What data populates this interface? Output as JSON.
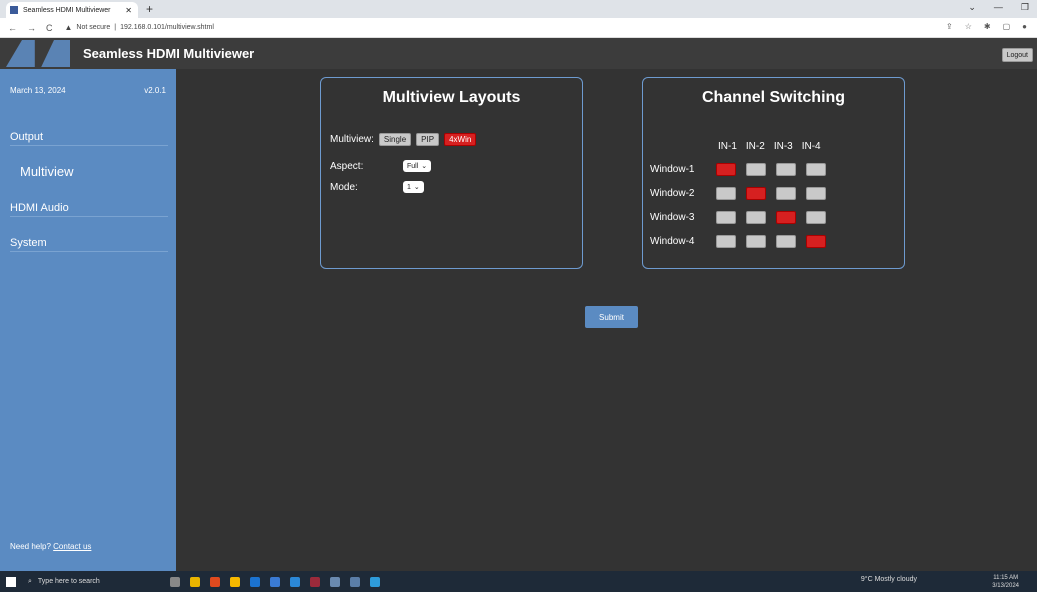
{
  "browser": {
    "tab_title": "Seamless HDMI Multiviewer",
    "address_security": "Not secure",
    "address_url": "192.168.0.101/multiview.shtml"
  },
  "app": {
    "title": "Seamless HDMI Multiviewer",
    "logout_label": "Logout"
  },
  "sidebar": {
    "date": "March 13, 2024",
    "version": "v2.0.1",
    "items": [
      {
        "label": "Output"
      },
      {
        "label": "Multiview"
      },
      {
        "label": "HDMI Audio"
      },
      {
        "label": "System"
      }
    ],
    "help_text": "Need help?",
    "help_link": "Contact us"
  },
  "multiview_panel": {
    "title": "Multiview Layouts",
    "multiview_label": "Multiview:",
    "buttons": [
      "Single",
      "PIP",
      "4xWin"
    ],
    "active_button": "4xWin",
    "aspect_label": "Aspect:",
    "aspect_value": "Full",
    "mode_label": "Mode:",
    "mode_value": "1"
  },
  "channel_panel": {
    "title": "Channel Switching",
    "inputs": [
      "IN-1",
      "IN-2",
      "IN-3",
      "IN-4"
    ],
    "windows": [
      {
        "label": "Window-1",
        "selected_input": 1
      },
      {
        "label": "Window-2",
        "selected_input": 2
      },
      {
        "label": "Window-3",
        "selected_input": 3
      },
      {
        "label": "Window-4",
        "selected_input": 4
      }
    ]
  },
  "submit_label": "Submit",
  "taskbar": {
    "search_placeholder": "Type here to search",
    "weather": "9°C  Mostly cloudy",
    "time": "11:15 AM",
    "date": "3/13/2024"
  },
  "colors": {
    "sidebar": "#5b8bc2",
    "active_red": "#d62020",
    "inactive_gray": "#c9c9c9",
    "panel_border": "#6e9bd0"
  }
}
